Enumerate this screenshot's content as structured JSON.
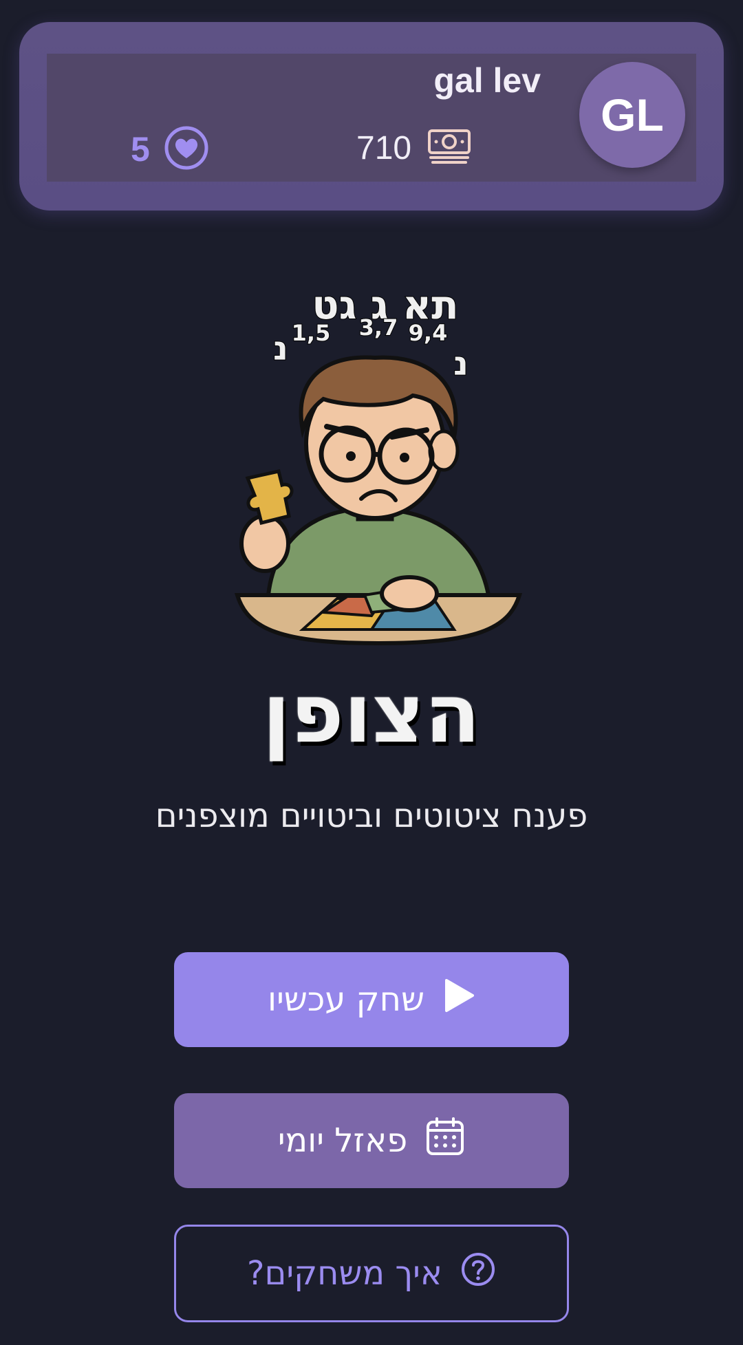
{
  "profile": {
    "initials": "GL",
    "name": "gal lev",
    "coins": "710",
    "lives": "5"
  },
  "illustration": {
    "letters_top": "תא ג גט",
    "numbers": [
      "1,5",
      "3,7",
      "9,4"
    ],
    "letter_left": "נ",
    "letter_right": "נ"
  },
  "app": {
    "title": "הצופן",
    "subtitle": "פענח ציטוטים וביטויים מוצפנים"
  },
  "buttons": {
    "play": "שחק עכשיו",
    "daily": "פאזל יומי",
    "help": "איך משחקים?"
  },
  "colors": {
    "background": "#1b1d2b",
    "card": "#5e5285",
    "accent": "#9586ea",
    "secondary_button": "#7c67a9"
  },
  "icons": {
    "coins": "money-icon",
    "lives": "heart-icon",
    "play": "play-icon",
    "daily": "calendar-icon",
    "help": "question-circle-icon"
  }
}
